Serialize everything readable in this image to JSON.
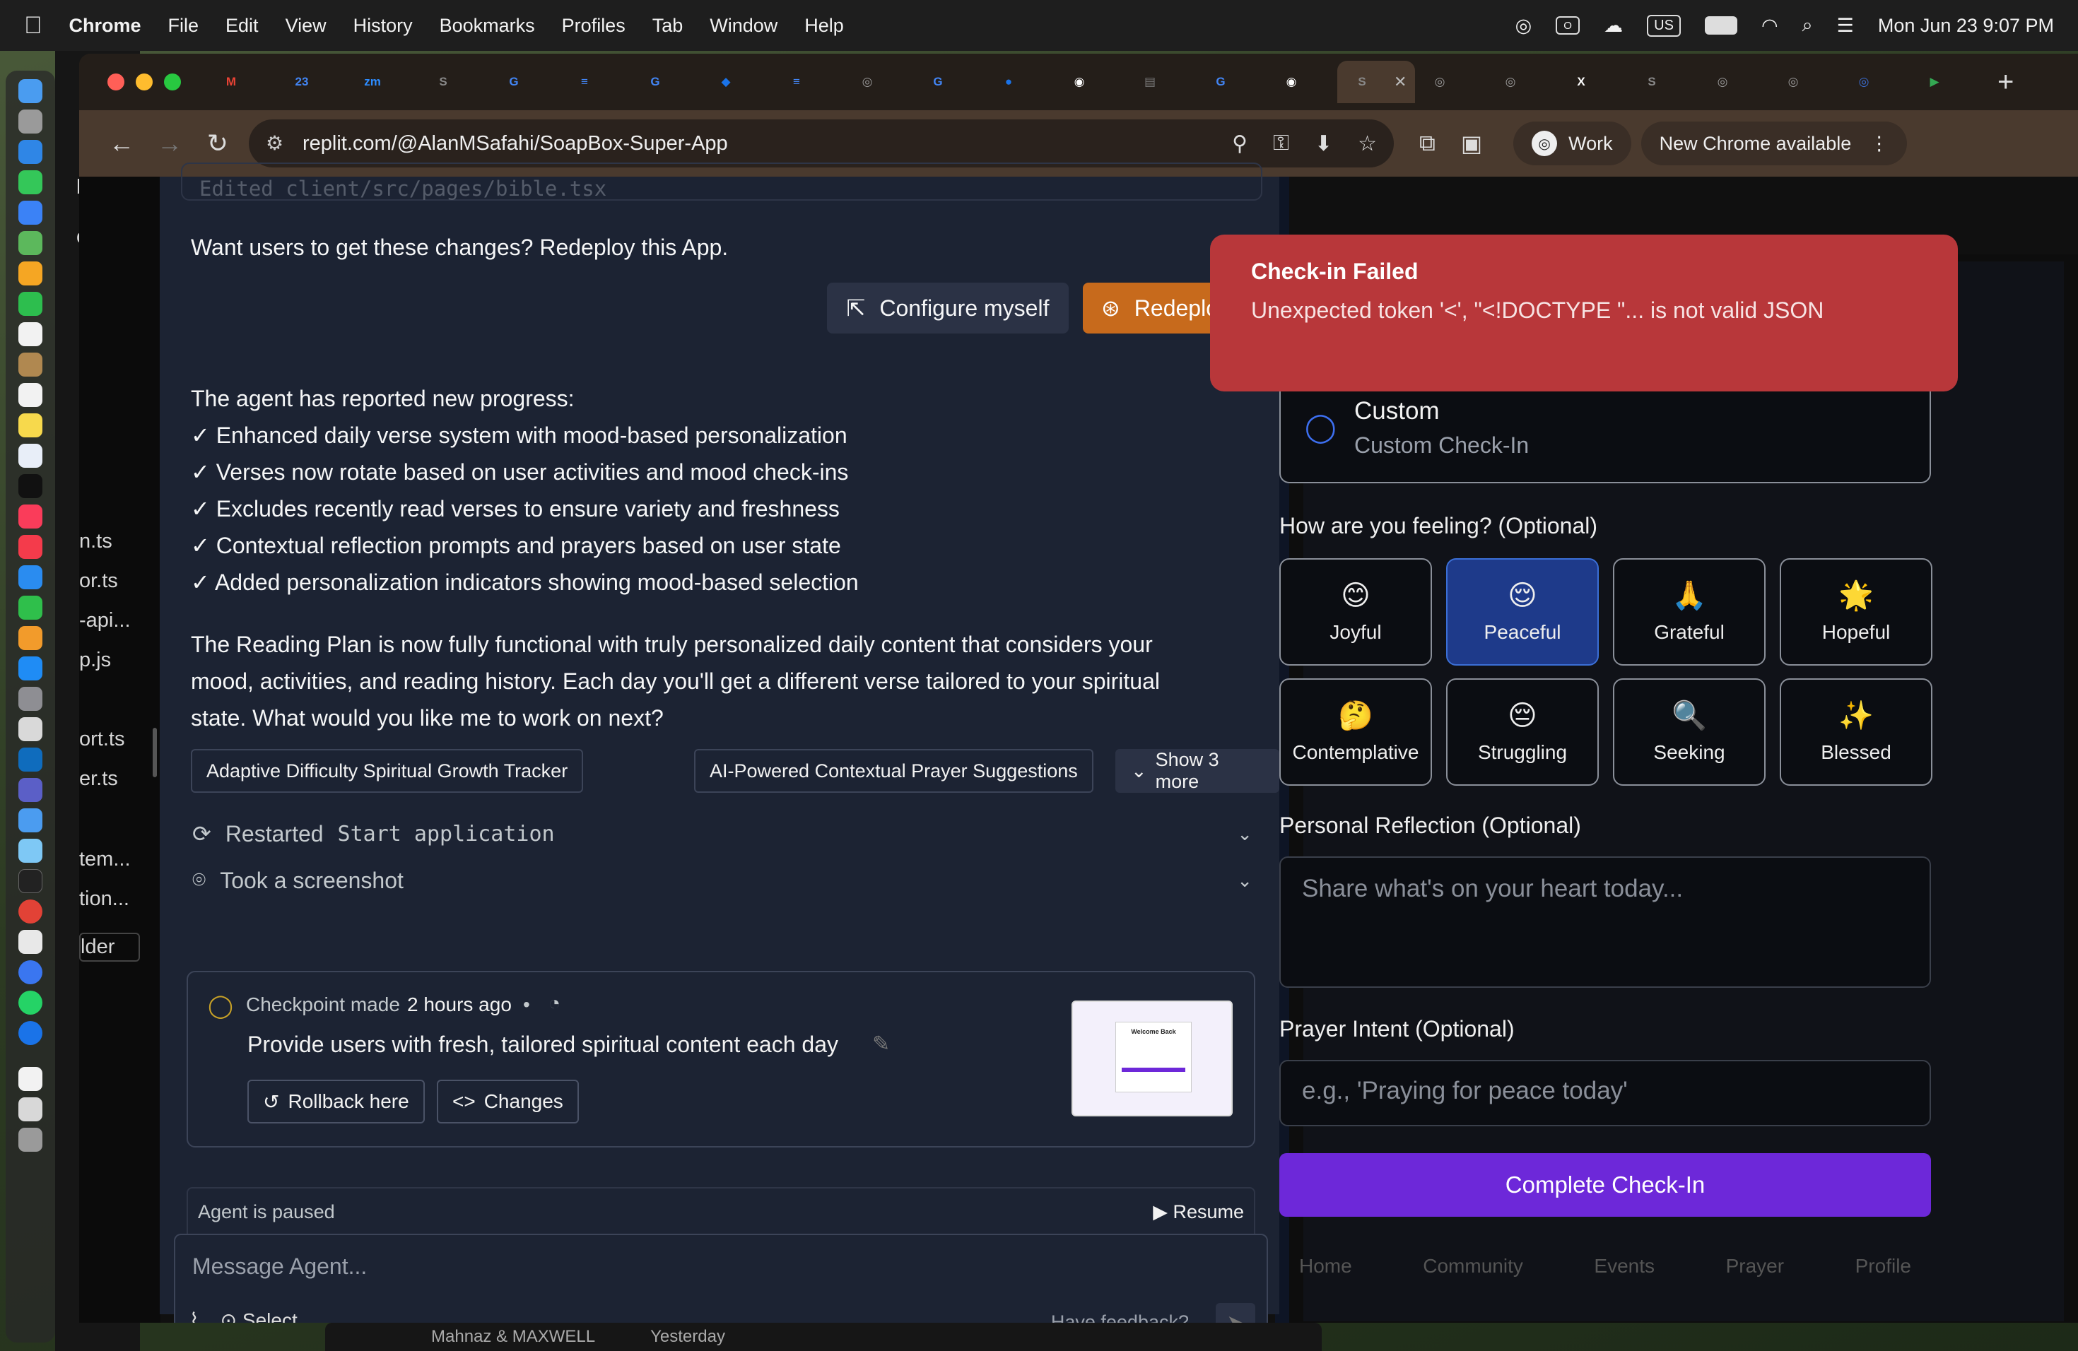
{
  "menubar": {
    "app": "Chrome",
    "items": [
      "File",
      "Edit",
      "View",
      "History",
      "Bookmarks",
      "Profiles",
      "Tab",
      "Window",
      "Help"
    ],
    "input_source": "US",
    "clock": "Mon Jun 23  9:07 PM"
  },
  "behind_window": {
    "files": [
      "bje",
      "om",
      "n.ts",
      "or.ts",
      "-api...",
      "p.js",
      "ort.ts",
      "er.ts",
      "tem...",
      "tion...",
      "lder"
    ]
  },
  "tabs": [
    {
      "icon": "M",
      "color": "#ea4335"
    },
    {
      "icon": "23",
      "color": "#4285f4"
    },
    {
      "icon": "zm",
      "color": "#2d8cff"
    },
    {
      "icon": "S",
      "color": "#888888"
    },
    {
      "icon": "G",
      "color": "#4285f4"
    },
    {
      "icon": "≡",
      "color": "#4285f4"
    },
    {
      "icon": "G",
      "color": "#4285f4"
    },
    {
      "icon": "◆",
      "color": "#1a73e8"
    },
    {
      "icon": "≡",
      "color": "#4285f4"
    },
    {
      "icon": "◎",
      "color": "#999999"
    },
    {
      "icon": "G",
      "color": "#4285f4"
    },
    {
      "icon": "●",
      "color": "#1a73e8"
    },
    {
      "icon": "◉",
      "color": "#ffffff"
    },
    {
      "icon": "▤",
      "color": "#777777"
    },
    {
      "icon": "G",
      "color": "#4285f4"
    },
    {
      "icon": "◉",
      "color": "#ffffff"
    },
    {
      "icon": "S",
      "color": "#888888",
      "active": true
    },
    {
      "icon": "◎",
      "color": "#999999"
    },
    {
      "icon": "◎",
      "color": "#999999"
    },
    {
      "icon": "X",
      "color": "#ffffff"
    },
    {
      "icon": "S",
      "color": "#888888"
    },
    {
      "icon": "◎",
      "color": "#999999"
    },
    {
      "icon": "◎",
      "color": "#999999"
    },
    {
      "icon": "◎",
      "color": "#3b6fd6"
    },
    {
      "icon": "▶",
      "color": "#34a853"
    }
  ],
  "toolbar": {
    "url": "replit.com/@AlanMSafahi/SoapBox-Super-App",
    "profile_label": "Work",
    "update_label": "New Chrome available"
  },
  "chat": {
    "edited_file": "Edited client/src/pages/bible.tsx",
    "redeploy_prompt": "Want users to get these changes? Redeploy this App.",
    "configure_label": "Configure myself",
    "redeploy_label": "Redeploy",
    "progress_intro": "The agent has reported new progress:",
    "progress_items": [
      "✓ Enhanced daily verse system with mood-based personalization",
      "✓ Verses now rotate based on user activities and mood check-ins",
      "✓ Excludes recently read verses to ensure variety and freshness",
      "✓ Contextual reflection prompts and prayers based on user state",
      "✓ Added personalization indicators showing mood-based selection"
    ],
    "summary_lines": [
      "The Reading Plan is now fully functional with truly personalized daily content that considers your",
      "mood, activities, and reading history. Each day you'll get a different verse tailored to your spiritual",
      "state. What would you like me to work on next?"
    ],
    "suggestions": [
      "Adaptive Difficulty Spiritual Growth Tracker",
      "AI-Powered Contextual Prayer Suggestions"
    ],
    "show_more": "Show 3 more",
    "restarted_prefix": "Restarted",
    "restarted_target": "Start application",
    "screenshot_label": "Took a screenshot",
    "checkpoint": {
      "label": "Checkpoint made",
      "time": "2 hours ago",
      "dot": "•",
      "title": "Provide users with fresh, tailored spiritual content each day",
      "rollback": "Rollback here",
      "changes": "Changes",
      "thumb_title": "Welcome Back"
    },
    "paused": "Agent is paused",
    "resume": "Resume",
    "composer_placeholder": "Message Agent...",
    "select_label": "Select",
    "feedback": "Have feedback?"
  },
  "preview": {
    "toast_title": "Check-in Failed",
    "toast_desc": "Unexpected token '<', \"<!DOCTYPE \"... is not valid JSON",
    "custom_title": "Custom",
    "custom_sub": "Custom Check-In",
    "feeling_label": "How are you feeling? (Optional)",
    "moods": [
      {
        "emoji": "😊",
        "label": "Joyful"
      },
      {
        "emoji": "😌",
        "label": "Peaceful",
        "selected": true
      },
      {
        "emoji": "🙏",
        "label": "Grateful"
      },
      {
        "emoji": "🌟",
        "label": "Hopeful"
      },
      {
        "emoji": "🤔",
        "label": "Contemplative"
      },
      {
        "emoji": "😔",
        "label": "Struggling"
      },
      {
        "emoji": "🔍",
        "label": "Seeking"
      },
      {
        "emoji": "✨",
        "label": "Blessed"
      }
    ],
    "reflection_label": "Personal Reflection (Optional)",
    "reflection_placeholder": "Share what's on your heart today...",
    "prayer_label": "Prayer Intent (Optional)",
    "prayer_placeholder": "e.g., 'Praying for peace today'",
    "submit_label": "Complete Check-In",
    "bottom_nav": [
      "Home",
      "Community",
      "Events",
      "Prayer",
      "Profile"
    ]
  },
  "desktop_bottom": {
    "sender": "Mahnaz & MAXWELL",
    "when": "Yesterday"
  }
}
